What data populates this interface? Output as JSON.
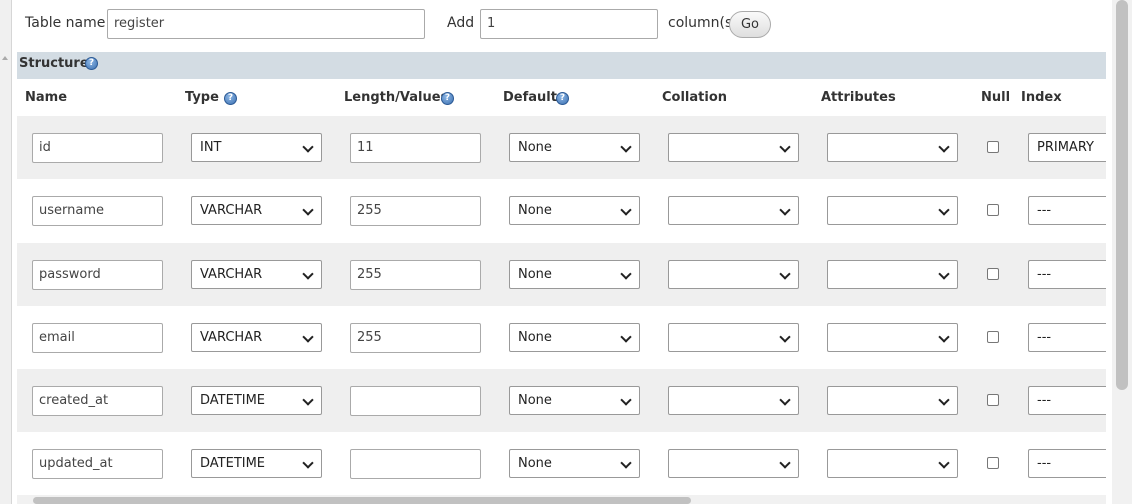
{
  "table_form": {
    "table_name_label": "Table name:",
    "table_name_value": "register",
    "add_label": "Add",
    "add_value": "1",
    "columns_label": "column(s)",
    "go_label": "Go"
  },
  "structure": {
    "title": "Structure",
    "help_glyph": "?",
    "headers": {
      "name": "Name",
      "type": "Type",
      "length": "Length/Values",
      "default": "Default",
      "collation": "Collation",
      "attributes": "Attributes",
      "null": "Null",
      "index": "Index"
    },
    "rows": [
      {
        "name": "id",
        "type": "INT",
        "length": "11",
        "default": "None",
        "collation": "",
        "attributes": "",
        "null": false,
        "index": "PRIMARY"
      },
      {
        "name": "username",
        "type": "VARCHAR",
        "length": "255",
        "default": "None",
        "collation": "",
        "attributes": "",
        "null": false,
        "index": "---"
      },
      {
        "name": "password",
        "type": "VARCHAR",
        "length": "255",
        "default": "None",
        "collation": "",
        "attributes": "",
        "null": false,
        "index": "---"
      },
      {
        "name": "email",
        "type": "VARCHAR",
        "length": "255",
        "default": "None",
        "collation": "",
        "attributes": "",
        "null": false,
        "index": "---"
      },
      {
        "name": "created_at",
        "type": "DATETIME",
        "length": "",
        "default": "None",
        "collation": "",
        "attributes": "",
        "null": false,
        "index": "---"
      },
      {
        "name": "updated_at",
        "type": "DATETIME",
        "length": "",
        "default": "None",
        "collation": "",
        "attributes": "",
        "null": false,
        "index": "---"
      }
    ]
  },
  "colors": {
    "structure_bar": "#d3dce3",
    "row_alt": "#efefef"
  }
}
